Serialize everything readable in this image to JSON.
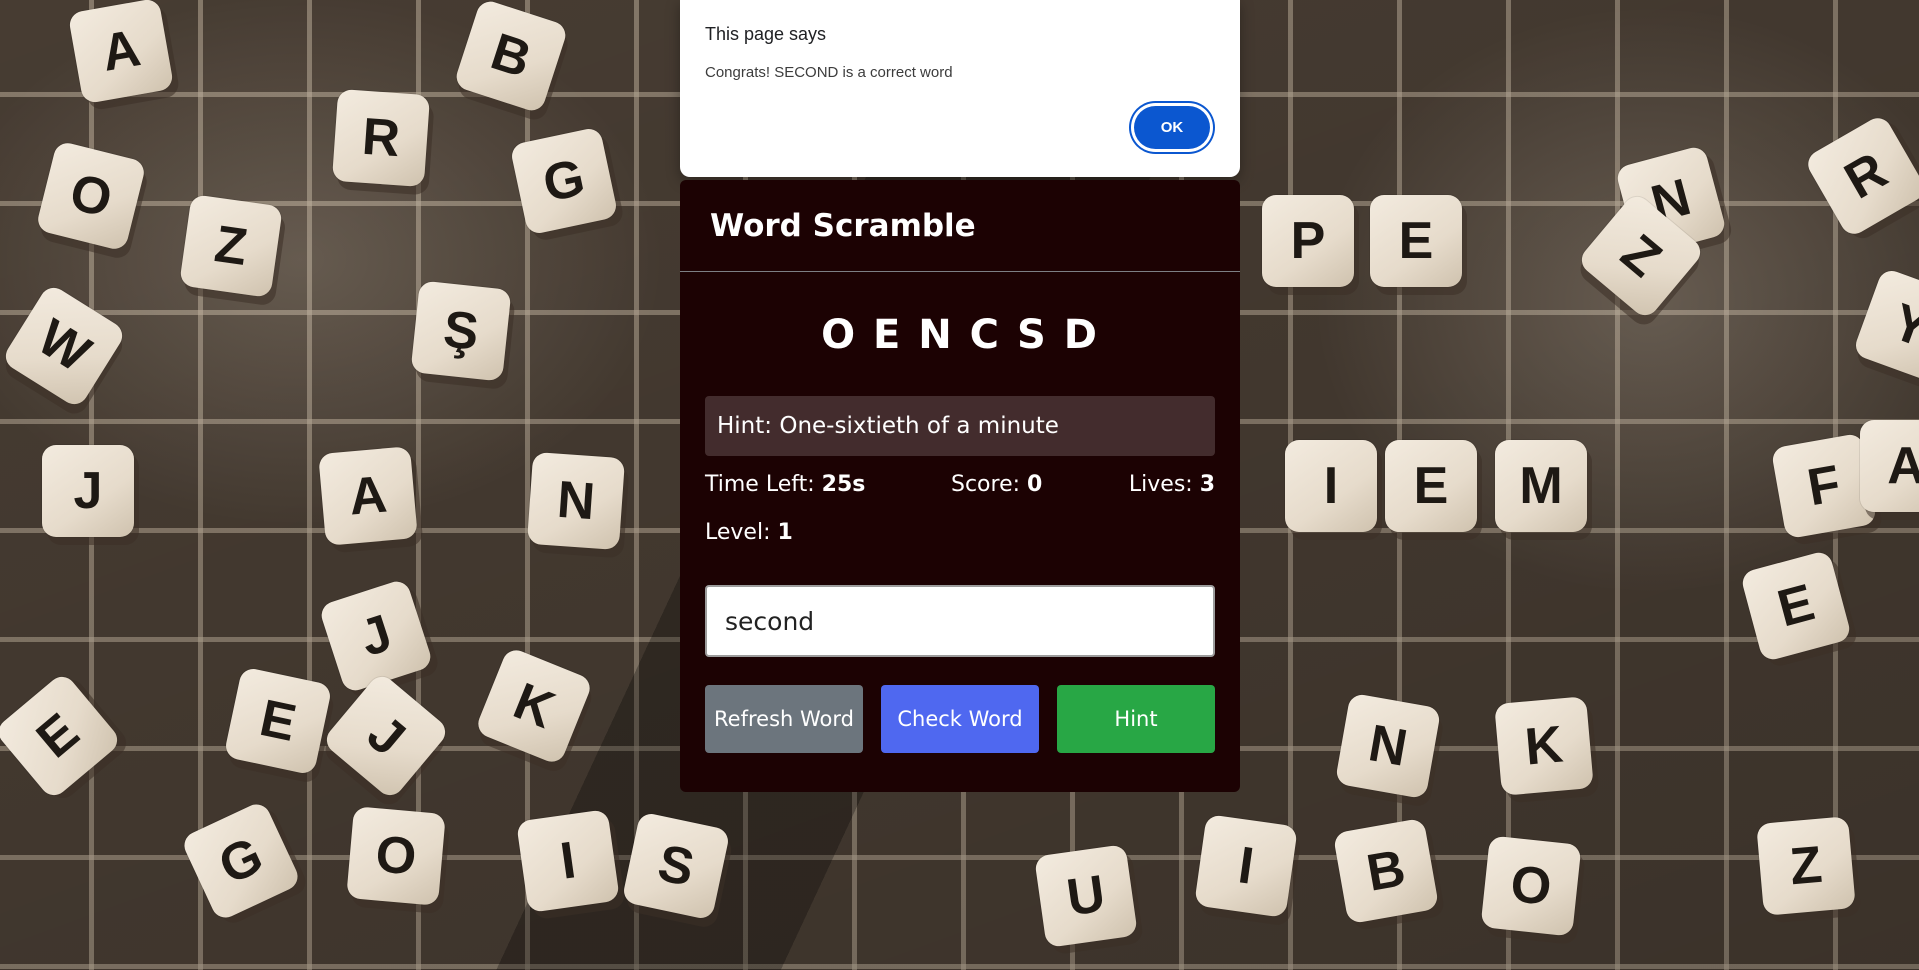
{
  "alert": {
    "title": "This page says",
    "message": "Congrats! SECOND is a correct word",
    "ok_label": "OK"
  },
  "game": {
    "title": "Word Scramble",
    "scrambled_word": "O E N C S D",
    "hint": "Hint: One-sixtieth of a minute",
    "time_label": "Time Left: ",
    "time_value": "25s",
    "score_label": "Score: ",
    "score_value": "0",
    "lives_label": "Lives: ",
    "lives_value": "3",
    "level_label": "Level: ",
    "level_value": "1",
    "input_value": "second",
    "buttons": {
      "refresh": "Refresh Word",
      "check": "Check Word",
      "hint": "Hint"
    }
  },
  "background_tiles": [
    "A",
    "B",
    "R",
    "G",
    "O",
    "Z",
    "W",
    "Ş",
    "J",
    "A",
    "N",
    "J",
    "E",
    "K",
    "E",
    "G",
    "O",
    "I",
    "P",
    "E",
    "I",
    "E",
    "M",
    "N",
    "K",
    "I",
    "B",
    "O",
    "Z",
    "N",
    "E",
    "F",
    "R",
    "Y",
    "A",
    "Z",
    "J",
    "S",
    "U"
  ],
  "colors": {
    "card_bg": "#1c0203",
    "hint_bg": "#432c2d",
    "refresh_btn": "#6c757d",
    "check_btn": "#4f68f0",
    "hint_btn": "#28a745",
    "alert_ok": "#0b57d0"
  }
}
